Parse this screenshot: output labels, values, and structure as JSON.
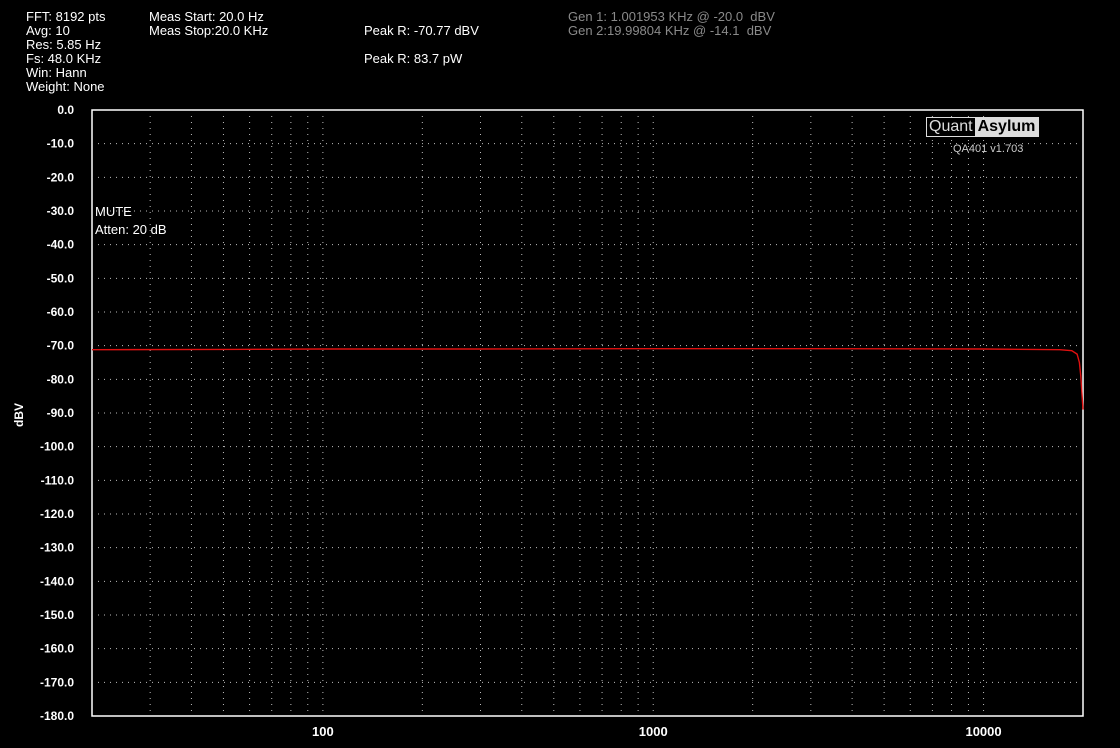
{
  "info": {
    "fft": "FFT: 8192 pts",
    "avg": "Avg: 10",
    "res": "Res: 5.85 Hz",
    "fs": "Fs: 48.0 KHz",
    "win": "Win: Hann",
    "weight": "Weight: None",
    "meas_start": "Meas Start: 20.0 Hz",
    "meas_stop": "Meas Stop:20.0 KHz",
    "peak_dbv": "Peak R: -70.77 dBV",
    "peak_pw": "Peak R: 83.7 pW",
    "gen1": "Gen 1: 1.001953 KHz @ -20.0  dBV",
    "gen2": "Gen 2:19.99804 KHz @ -14.1  dBV"
  },
  "logo": {
    "quant": "Quant",
    "asylum": "Asylum",
    "version": "QA401 v1.703"
  },
  "annotations": {
    "mute": "MUTE",
    "atten": "Atten: 20 dB"
  },
  "chart_data": {
    "type": "line",
    "xscale": "log",
    "xlim": [
      20,
      20000
    ],
    "ylim": [
      -180,
      0
    ],
    "ylabel": "dBV",
    "xlabel": "",
    "y_ticks": [
      "0.0",
      "-10.0",
      "-20.0",
      "-30.0",
      "-40.0",
      "-50.0",
      "-60.0",
      "-70.0",
      "-80.0",
      "-90.0",
      "-100.0",
      "-110.0",
      "-120.0",
      "-130.0",
      "-140.0",
      "-150.0",
      "-160.0",
      "-170.0",
      "-180.0"
    ],
    "y_tick_values": [
      0,
      -10,
      -20,
      -30,
      -40,
      -50,
      -60,
      -70,
      -80,
      -90,
      -100,
      -110,
      -120,
      -130,
      -140,
      -150,
      -160,
      -170,
      -180
    ],
    "x_ticks": [
      "100",
      "1000",
      "10000"
    ],
    "x_tick_values": [
      100,
      1000,
      10000
    ],
    "grid": true,
    "series": [
      {
        "color": "#e01010",
        "x": [
          20,
          50,
          100,
          300,
          1000,
          3000,
          10000,
          14000,
          17000,
          18500,
          19200,
          19500,
          19700,
          19850,
          20000
        ],
        "y": [
          -71.2,
          -71.1,
          -71.0,
          -71.0,
          -70.9,
          -70.9,
          -71.0,
          -71.1,
          -71.2,
          -71.5,
          -72.5,
          -75,
          -79,
          -84,
          -89
        ]
      }
    ]
  }
}
